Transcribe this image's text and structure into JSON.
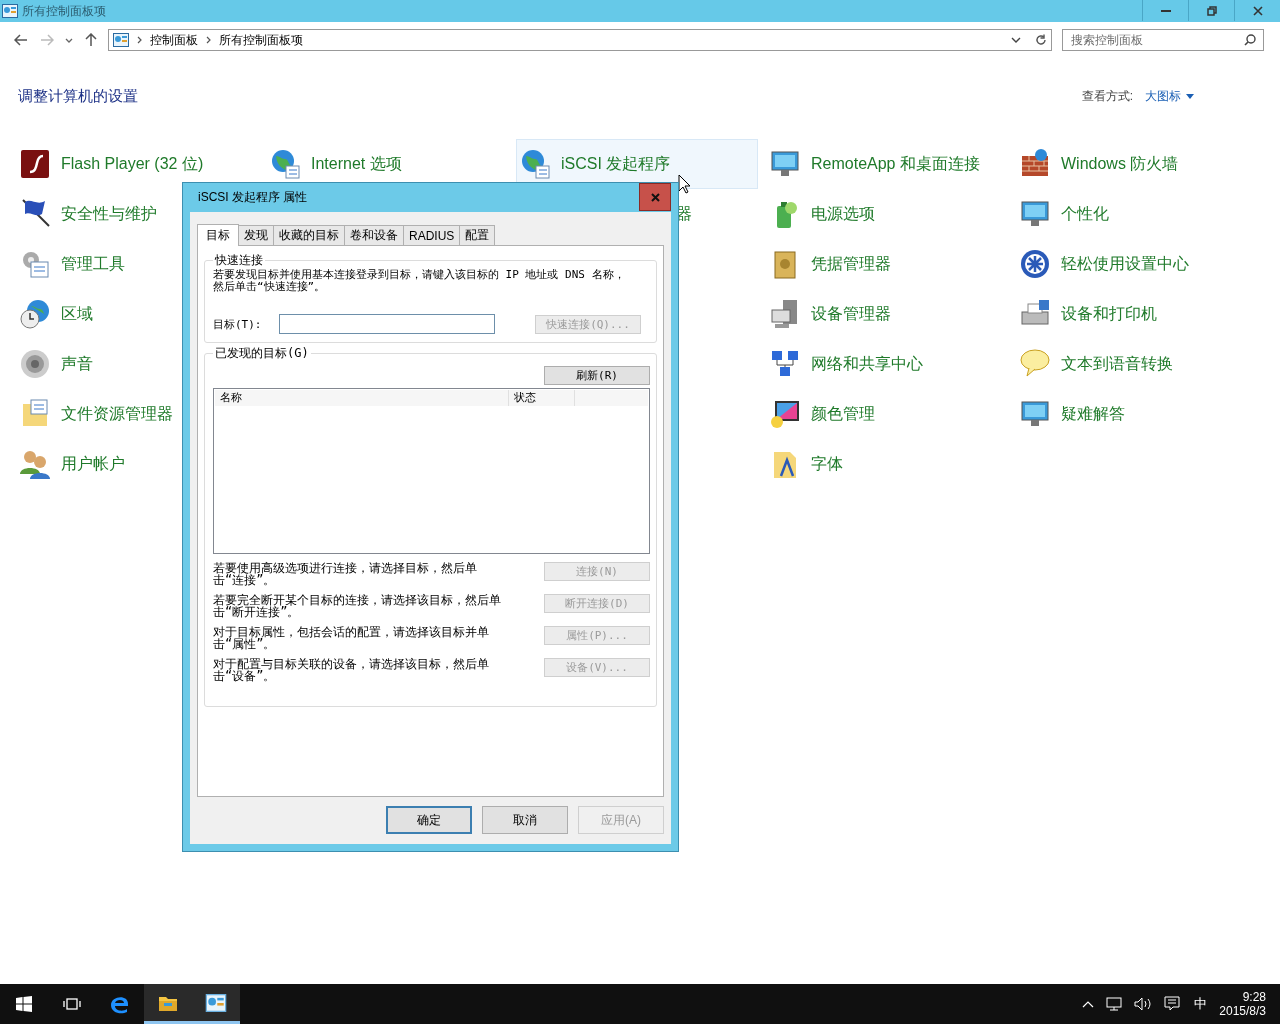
{
  "window": {
    "title": "所有控制面板项"
  },
  "address": {
    "breadcrumb": [
      "控制面板",
      "所有控制面板项"
    ],
    "search_placeholder": "搜索控制面板"
  },
  "heading": "调整计算机的设置",
  "view_by": {
    "label": "查看方式:",
    "value": "大图标"
  },
  "columns": [
    {
      "items": [
        {
          "label": "Flash Player (32 位)",
          "highlighted": false
        },
        {
          "label": "安全性与维护",
          "highlighted": false
        },
        {
          "label": "管理工具",
          "highlighted": false
        },
        {
          "label": "区域",
          "highlighted": false
        },
        {
          "label": "声音",
          "highlighted": false
        },
        {
          "label": "文件资源管理器",
          "highlighted": false
        },
        {
          "label": "用户帐户",
          "highlighted": false
        }
      ]
    },
    {
      "items": [
        {
          "label": "Internet 选项",
          "highlighted": false
        }
      ]
    },
    {
      "items": [
        {
          "label": "iSCSI 发起程序",
          "highlighted": true
        },
        {
          "label": "器",
          "highlighted": false
        }
      ]
    },
    {
      "items": [
        {
          "label": "RemoteApp 和桌面连接",
          "highlighted": false
        },
        {
          "label": "电源选项",
          "highlighted": false
        },
        {
          "label": "凭据管理器",
          "highlighted": false
        },
        {
          "label": "设备管理器",
          "highlighted": false
        },
        {
          "label": "网络和共享中心",
          "highlighted": false
        },
        {
          "label": "颜色管理",
          "highlighted": false
        },
        {
          "label": "字体",
          "highlighted": false
        }
      ]
    },
    {
      "items": [
        {
          "label": "Windows 防火墙",
          "highlighted": false
        },
        {
          "label": "个性化",
          "highlighted": false
        },
        {
          "label": "轻松使用设置中心",
          "highlighted": false
        },
        {
          "label": "设备和打印机",
          "highlighted": false
        },
        {
          "label": "文本到语音转换",
          "highlighted": false
        },
        {
          "label": "疑难解答",
          "highlighted": false
        }
      ]
    }
  ],
  "dialog": {
    "title": "iSCSI 发起程序 属性",
    "tabs": [
      {
        "label": "目标",
        "selected": true
      },
      {
        "label": "发现",
        "selected": false
      },
      {
        "label": "收藏的目标",
        "selected": false
      },
      {
        "label": "卷和设备",
        "selected": false
      },
      {
        "label": "RADIUS",
        "selected": false
      },
      {
        "label": "配置",
        "selected": false
      }
    ],
    "quick_connect": {
      "title": "快速连接",
      "description": "若要发现目标并使用基本连接登录到目标，请键入该目标的 IP 地址或 DNS 名称，然后单击“快速连接”。",
      "target_label": "目标(T):",
      "button": {
        "label": "快速连接(Q)...",
        "disabled": true
      }
    },
    "discovered": {
      "title": "已发现的目标(G)",
      "refresh": {
        "label": "刷新(R)",
        "disabled": false
      },
      "columns": [
        "名称",
        "状态"
      ]
    },
    "actions": [
      {
        "description": "若要使用高级选项进行连接，请选择目标，然后单击“连接”。",
        "button": {
          "label": "连接(N)",
          "disabled": true
        }
      },
      {
        "description": "若要完全断开某个目标的连接，请选择该目标，然后单击“断开连接”。",
        "button": {
          "label": "断开连接(D)",
          "disabled": true
        }
      },
      {
        "description": "对于目标属性，包括会话的配置，请选择该目标并单击“属性”。",
        "button": {
          "label": "属性(P)...",
          "disabled": true
        }
      },
      {
        "description": "对于配置与目标关联的设备，请选择该目标，然后单击“设备”。",
        "button": {
          "label": "设备(V)...",
          "disabled": true
        }
      }
    ],
    "buttons": [
      {
        "label": "确定",
        "disabled": false,
        "default": true
      },
      {
        "label": "取消",
        "disabled": false,
        "default": false
      },
      {
        "label": "应用(A)",
        "disabled": true,
        "default": false
      }
    ]
  },
  "taskbar": {
    "apps": [
      {
        "active": false
      },
      {
        "active": false
      },
      {
        "active": false
      },
      {
        "active": true
      },
      {
        "active": true
      }
    ],
    "ime": "中",
    "time": "9:28",
    "date": "2015/8/3"
  }
}
